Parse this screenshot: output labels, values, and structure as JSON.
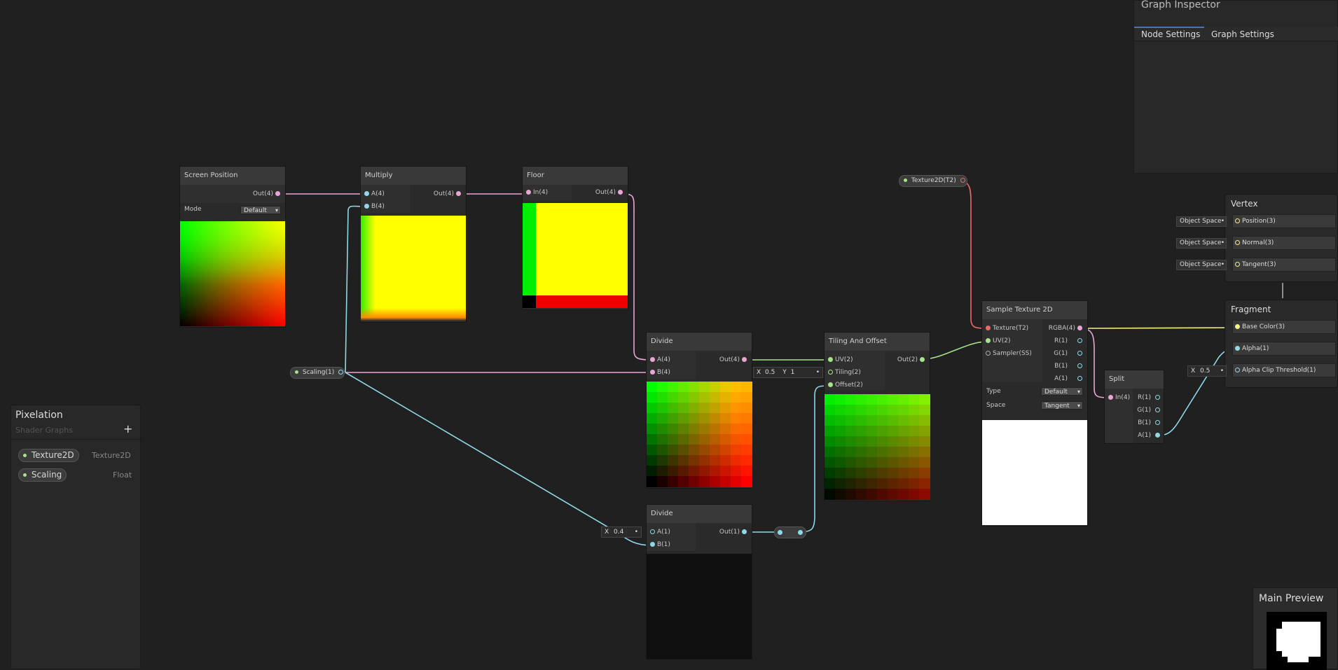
{
  "inspector": {
    "title": "Graph Inspector",
    "tabs": [
      {
        "label": "Node Settings",
        "active": true
      },
      {
        "label": "Graph Settings",
        "active": false
      }
    ]
  },
  "blackboard": {
    "title": "Pixelation",
    "subtitle": "Shader Graphs",
    "add_glyph": "+",
    "properties": [
      {
        "name": "Texture2D",
        "type": "Texture2D"
      },
      {
        "name": "Scaling",
        "type": "Float"
      }
    ]
  },
  "nodes": {
    "screen_position": {
      "title": "Screen Position",
      "out": "Out(4)",
      "mode_label": "Mode",
      "mode_value": "Default"
    },
    "multiply": {
      "title": "Multiply",
      "in_a": "A(4)",
      "in_b": "B(4)",
      "out": "Out(4)"
    },
    "floor": {
      "title": "Floor",
      "in": "In(4)",
      "out": "Out(4)"
    },
    "divide1": {
      "title": "Divide",
      "in_a": "A(4)",
      "in_b": "B(4)",
      "out": "Out(4)"
    },
    "divide2": {
      "title": "Divide",
      "in_a": "A(1)",
      "in_b": "B(1)",
      "out": "Out(1)",
      "a_x_label": "X",
      "a_x_value": "0.4"
    },
    "tiling": {
      "title": "Tiling And Offset",
      "uv": "UV(2)",
      "tiling": "Tiling(2)",
      "offset": "Offset(2)",
      "out": "Out(2)",
      "x_label": "X",
      "x_value": "0.5",
      "y_label": "Y",
      "y_value": "1"
    },
    "sample": {
      "title": "Sample Texture 2D",
      "texture": "Texture(T2)",
      "uv": "UV(2)",
      "sampler": "Sampler(SS)",
      "rgba": "RGBA(4)",
      "r": "R(1)",
      "g": "G(1)",
      "b": "B(1)",
      "a": "A(1)",
      "type_label": "Type",
      "type_value": "Default",
      "space_label": "Space",
      "space_value": "Tangent"
    },
    "split": {
      "title": "Split",
      "in": "In(4)",
      "r": "R(1)",
      "g": "G(1)",
      "b": "B(1)",
      "a": "A(1)"
    },
    "texture_prop": {
      "label": "Texture2D(T2)"
    },
    "scaling_prop": {
      "label": "Scaling(1)"
    }
  },
  "vertex": {
    "title": "Vertex",
    "slots": [
      {
        "space": "Object Space",
        "label": "Position(3)"
      },
      {
        "space": "Object Space",
        "label": "Normal(3)"
      },
      {
        "space": "Object Space",
        "label": "Tangent(3)"
      }
    ]
  },
  "fragment": {
    "title": "Fragment",
    "slots": [
      {
        "label": "Base Color(3)"
      },
      {
        "label": "Alpha(1)"
      },
      {
        "label": "Alpha Clip Threshold(1)",
        "x_label": "X",
        "x_value": "0.5"
      }
    ]
  },
  "main_preview": {
    "title": "Main Preview"
  },
  "colors": {
    "pink": "#e9a6d4",
    "cyan": "#8fd9e6",
    "green": "#a6e38a",
    "yellow": "#f5f08a",
    "red": "#e96a6a"
  }
}
